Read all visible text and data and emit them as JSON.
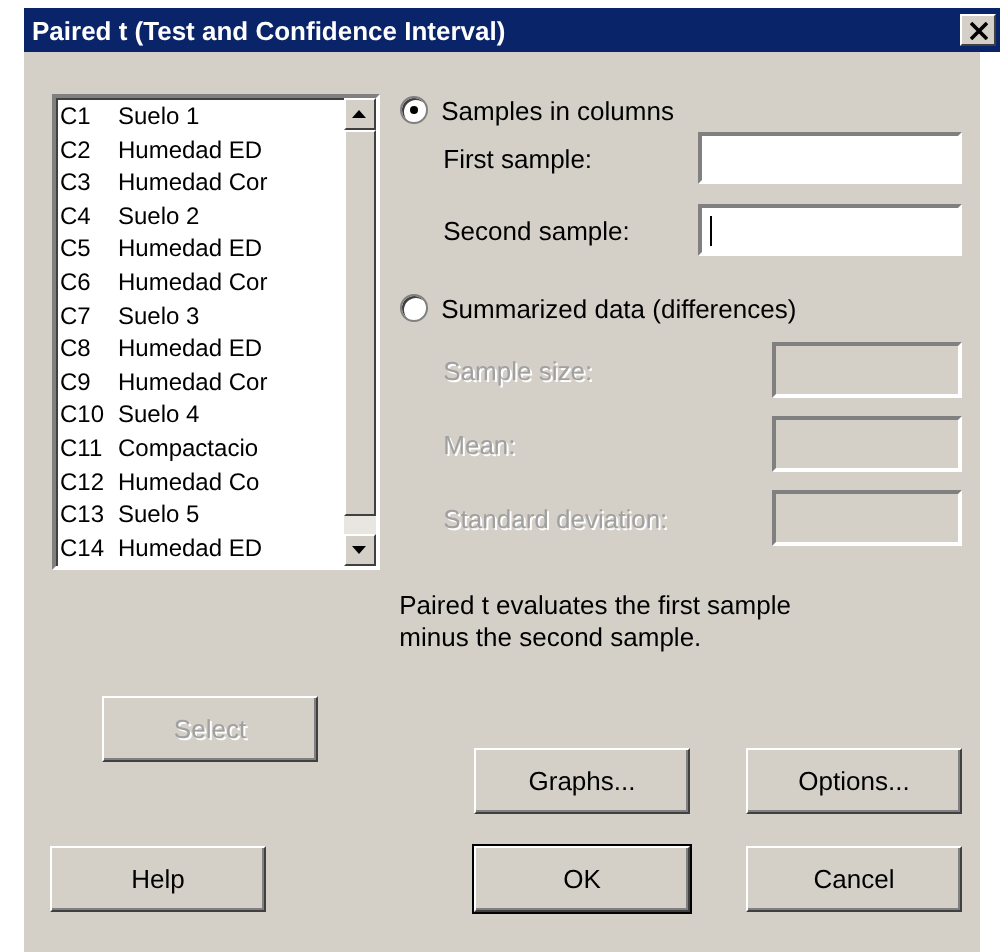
{
  "window": {
    "title": "Paired t (Test and Confidence Interval)"
  },
  "columns": [
    {
      "number": "C1",
      "name": "Suelo 1"
    },
    {
      "number": "C2",
      "name": "Humedad ED"
    },
    {
      "number": "C3",
      "name": "Humedad Cor"
    },
    {
      "number": "C4",
      "name": "Suelo 2"
    },
    {
      "number": "C5",
      "name": "Humedad ED"
    },
    {
      "number": "C6",
      "name": "Humedad Cor"
    },
    {
      "number": "C7",
      "name": "Suelo 3"
    },
    {
      "number": "C8",
      "name": "Humedad ED"
    },
    {
      "number": "C9",
      "name": "Humedad Cor"
    },
    {
      "number": "C10",
      "name": "Suelo 4"
    },
    {
      "number": "C11",
      "name": "Compactacio"
    },
    {
      "number": "C12",
      "name": "Humedad Co"
    },
    {
      "number": "C13",
      "name": "Suelo 5"
    },
    {
      "number": "C14",
      "name": "Humedad ED"
    }
  ],
  "options": [
    {
      "label": "Samples in columns",
      "selected": true,
      "fields": [
        {
          "label": "First sample:",
          "disabled": false,
          "focused": false
        },
        {
          "label": "Second sample:",
          "disabled": false,
          "focused": true
        }
      ]
    },
    {
      "label": "Summarized data (differences)",
      "selected": false,
      "fields": [
        {
          "label": "Sample size:",
          "disabled": true,
          "focused": false
        },
        {
          "label": "Mean:",
          "disabled": true,
          "focused": false
        },
        {
          "label": "Standard deviation:",
          "disabled": true,
          "focused": false
        }
      ]
    }
  ],
  "note": "Paired t evaluates the first sample minus the second sample.",
  "select_button": {
    "label": "Select",
    "disabled": true
  },
  "buttons_row_1": [
    {
      "label": "Graphs...",
      "default": false
    },
    {
      "label": "Options...",
      "default": false
    }
  ],
  "buttons_row_2": [
    {
      "label": "Help",
      "default": false
    },
    {
      "label": "OK",
      "default": true
    },
    {
      "label": "Cancel",
      "default": false
    }
  ]
}
